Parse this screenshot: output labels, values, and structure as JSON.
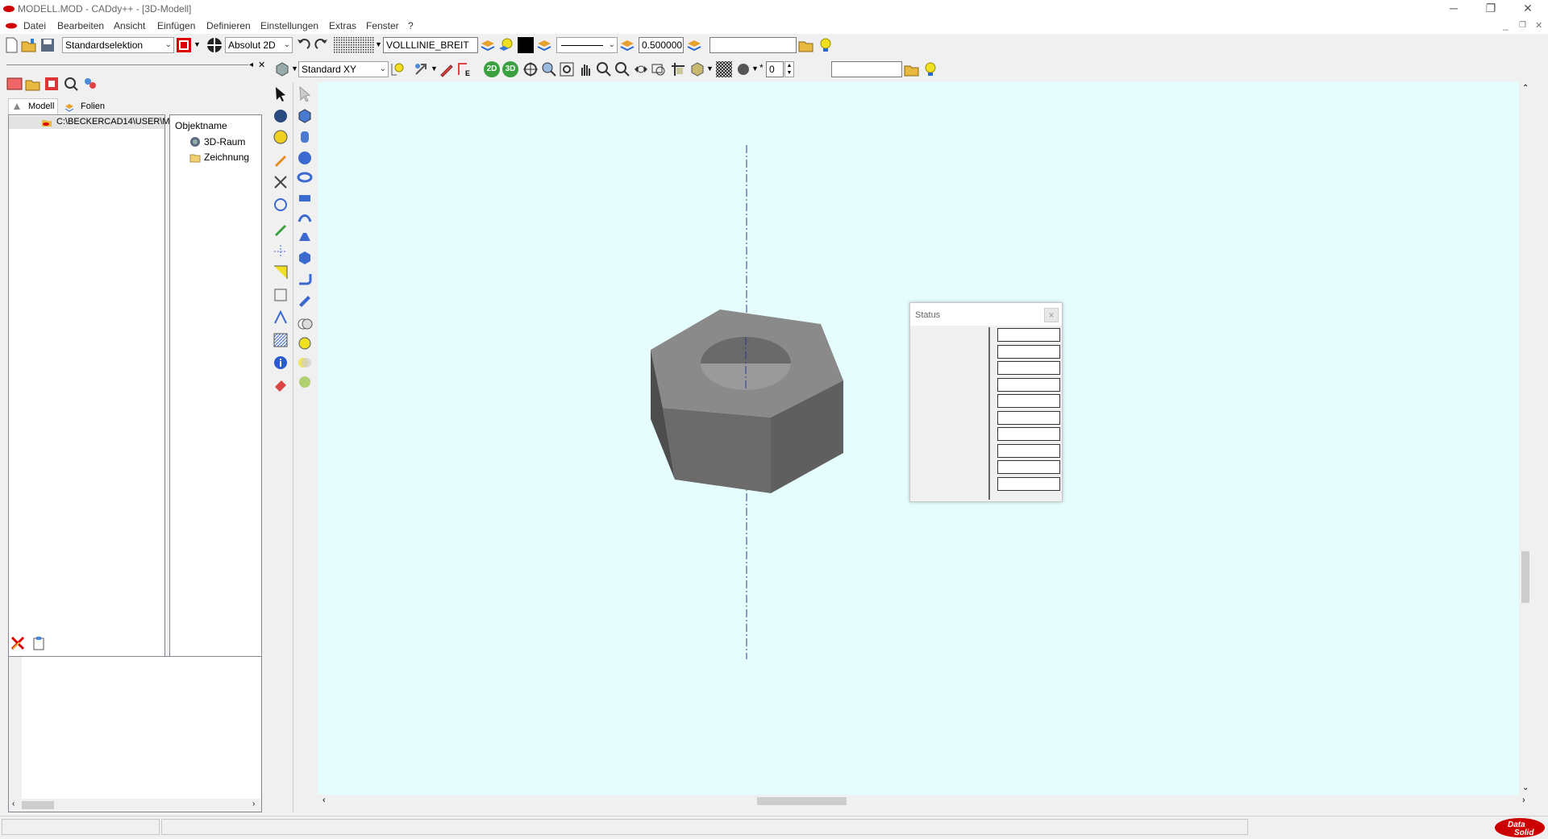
{
  "window": {
    "title": "MODELL.MOD  -  CADdy++ - [3D-Modell]",
    "controls": {
      "minimize": "─",
      "restore": "❐",
      "close": "✕"
    },
    "mdi_controls": {
      "minimize": "_",
      "restore": "❐",
      "close": "✕"
    }
  },
  "menu": {
    "items": [
      "Datei",
      "Bearbeiten",
      "Ansicht",
      "Einfügen",
      "Definieren",
      "Einstellungen",
      "Extras",
      "Fenster",
      "?"
    ]
  },
  "toolbar1": {
    "selection_mode": "Standardselektion",
    "coordinate_mode": "Absolut 2D",
    "line_type": "VOLLLINIE_BREIT",
    "line_width": "0.500000",
    "layer_field": ""
  },
  "toolbar2": {
    "view": "Standard XY",
    "label_2d": "2D",
    "label_3d": "3D",
    "counter": "0",
    "extra_field": "",
    "edge_label": "E"
  },
  "left_panel": {
    "tabs": [
      "Modell",
      "Folien"
    ],
    "tree_path": "C:\\BECKERCAD14\\USER\\M",
    "object_header": "Objektname",
    "objects": [
      "3D-Raum",
      "Zeichnung"
    ]
  },
  "status_panel": {
    "title": "Status",
    "close": "×",
    "field_count": 10
  },
  "branding": {
    "logo_text_1": "Data",
    "logo_text_2": "Solid"
  },
  "colors": {
    "canvas": "#e6fdfd",
    "nut_top": "#8a8a8a",
    "nut_front": "#6b6b6b",
    "nut_left": "#4d4d4d",
    "axis": "#2a3a8a",
    "accent_red": "#d00000"
  }
}
